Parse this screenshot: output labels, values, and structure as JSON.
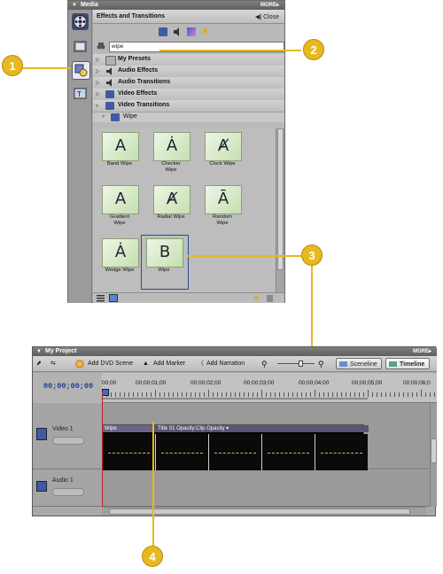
{
  "media_panel": {
    "title": "Media",
    "more": "MORE▸",
    "effects_title": "Effects and Transitions",
    "close_label": "Close",
    "search_value": "wipe",
    "categories": [
      {
        "label": "My Presets",
        "expanded": false
      },
      {
        "label": "Audio Effects",
        "expanded": false
      },
      {
        "label": "Audio Transitions",
        "expanded": false
      },
      {
        "label": "Video Effects",
        "expanded": false
      },
      {
        "label": "Video Transitions",
        "expanded": true
      }
    ],
    "subcategory": "Wipe",
    "transitions": [
      {
        "glyph": "A",
        "label": "Band Wipe"
      },
      {
        "glyph": "Ȧ",
        "label": "Checker Wipe"
      },
      {
        "glyph": "Ⱥ",
        "label": "Clock Wipe"
      },
      {
        "glyph": "A",
        "label": "Gradient Wipe"
      },
      {
        "glyph": "Ⱥ",
        "label": "Radial Wipe"
      },
      {
        "glyph": "Ā",
        "label": "Random Wipe"
      },
      {
        "glyph": "Ȧ",
        "label": "Wedge Wipe"
      },
      {
        "glyph": "B",
        "label": "Wipe"
      }
    ]
  },
  "callouts": [
    "1",
    "2",
    "3",
    "4"
  ],
  "project_panel": {
    "title": "My Project",
    "more": "MORE▸",
    "toolbar": {
      "add_dvd_scene": "Add DVD Scene",
      "add_marker": "Add Marker",
      "add_narration": "Add Narration",
      "sceneline": "Sceneline",
      "timeline": "Timeline"
    },
    "current_time": "00;00;00;00",
    "ruler_labels": [
      "00;00",
      "00;00;01;00",
      "00;00;02;00",
      "00;00;03;00",
      "00;00;04;00",
      "00;00;05;00",
      "00;00;06;0"
    ],
    "tracks": [
      {
        "name": "Video 1"
      },
      {
        "name": "Audio 1"
      }
    ],
    "clip": {
      "transition_label": "Wipe",
      "title_label": "Title 01  Opacity:Clip Opacity ▾"
    }
  },
  "colors": {
    "callout": "#e8b820",
    "timecode": "#1d3c8c",
    "playhead": "#c02020"
  }
}
